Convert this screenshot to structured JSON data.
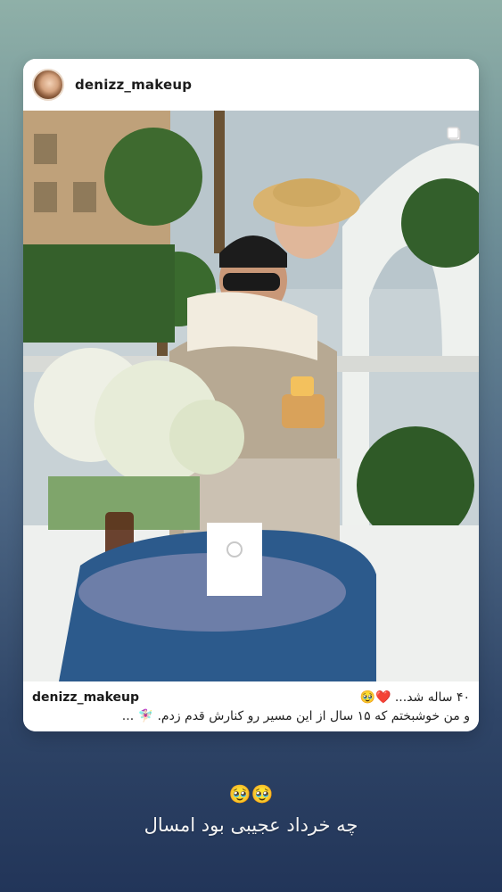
{
  "post": {
    "header_username": "denizz_makeup",
    "caption_username": "denizz_makeup",
    "caption_line_1": "۴۰ ساله شد... ❤️🥹",
    "caption_line_2": "و من خوشبختم که ۱۵ سال از این مسیر رو کنارش قدم زدم. 🧚🏻‍♀️ ...",
    "icons": {
      "avatar": "avatar-icon",
      "multi_photo": "multi-photo-icon"
    }
  },
  "story": {
    "emoji": "🥹🥹",
    "text": "چه خرداد عجیبی بود امسال"
  },
  "colors": {
    "card_bg": "#ffffff",
    "text_primary": "#1c1c1c",
    "background_top": "#8fb0a8",
    "background_bottom": "#223559",
    "story_text": "#f3f3f3"
  }
}
